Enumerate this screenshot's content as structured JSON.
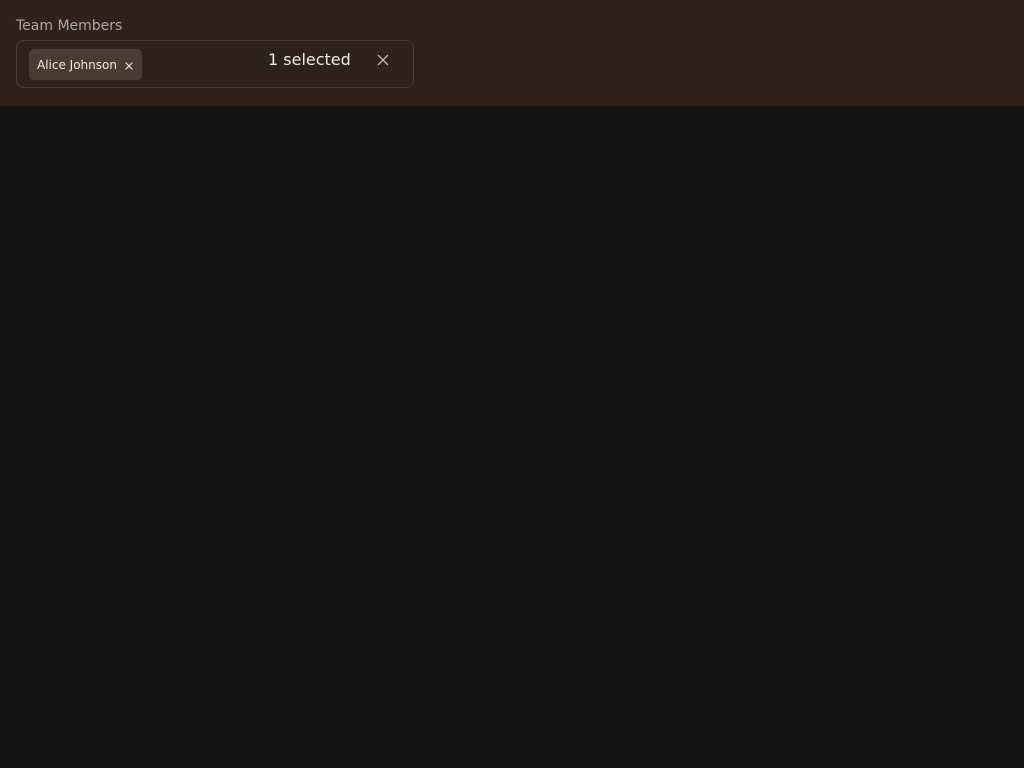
{
  "field": {
    "label": "Team Members"
  },
  "selection": {
    "chips": [
      {
        "label": "Alice Johnson"
      }
    ],
    "count_text": "1 selected"
  },
  "icons": {
    "chip_remove": "close-icon",
    "clear_all": "close-icon"
  },
  "colors": {
    "header_bg": "#2f221a",
    "page_bg": "#131313",
    "chip_bg": "#4a3c32",
    "text_primary": "#f3ebe3",
    "text_muted": "#b3a79c"
  }
}
